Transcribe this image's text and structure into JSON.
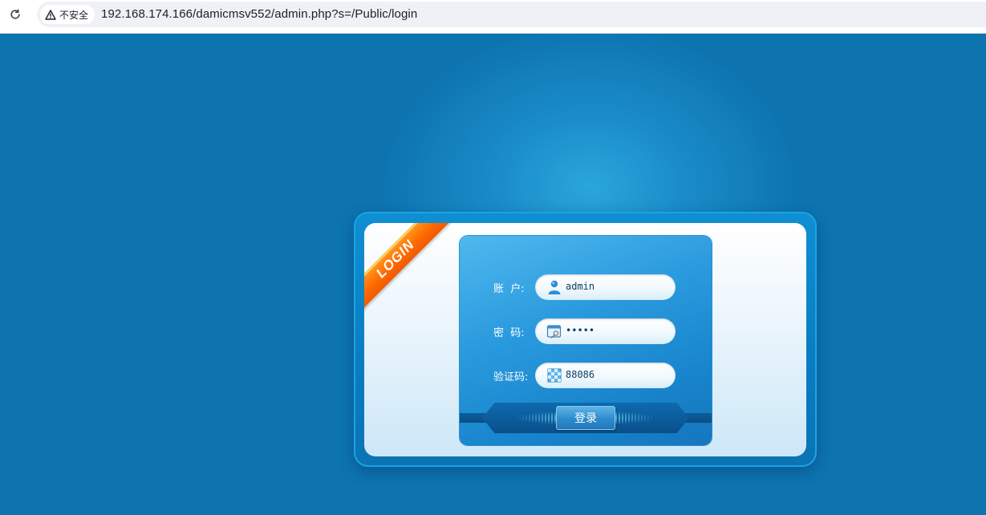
{
  "browser": {
    "security_label": "不安全",
    "url": "192.168.174.166/damicmsv552/admin.php?s=/Public/login"
  },
  "login": {
    "ribbon_text": "LOGIN",
    "fields": [
      {
        "label": "账  户:",
        "value": "admin",
        "icon": "user-icon"
      },
      {
        "label": "密  码:",
        "value": "•••••",
        "icon": "password-icon"
      },
      {
        "label": "验证码:",
        "value": "88086",
        "icon": "captcha-icon"
      }
    ],
    "submit_label": "登录"
  },
  "colors": {
    "page_background": "#0d74b0",
    "ribbon": "#ff6a00",
    "panel": "#2a9ade"
  }
}
